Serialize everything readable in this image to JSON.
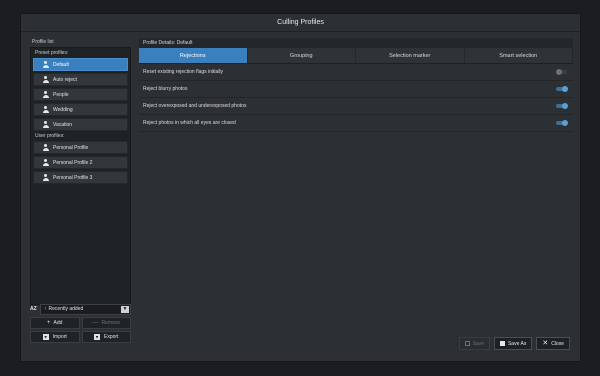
{
  "window": {
    "title": "Culling Profiles"
  },
  "left_panel": {
    "label": "Profile list",
    "preset_label": "Preset profiles:",
    "preset_profiles": [
      "Default",
      "Auto reject",
      "People",
      "Wedding",
      "Vacation"
    ],
    "user_label": "User profiles:",
    "user_profiles": [
      "Personal Profile",
      "Personal Profile 2",
      "Personal Profile 3"
    ],
    "sort_icon": "AZ",
    "sort_value": "Recently added",
    "add_label": "Add",
    "remove_label": "Remove",
    "import_label": "Import",
    "export_label": "Export"
  },
  "right_panel": {
    "header": "Profile Details: Default",
    "tabs": [
      "Rejections",
      "Grouping",
      "Selection marker",
      "Smart selection"
    ],
    "options": [
      {
        "label": "Reset existing rejection flags initially",
        "on": false
      },
      {
        "label": "Reject blurry photos",
        "on": true
      },
      {
        "label": "Reject overexposed and underexposed photos",
        "on": true
      },
      {
        "label": "Reject photos in which all eyes are closed",
        "on": true
      }
    ]
  },
  "footer": {
    "save_label": "Save",
    "save_as_label": "Save As",
    "close_label": "Close"
  },
  "colors": {
    "accent": "#3a7fbe",
    "toggle_on": "#5aa0d8"
  }
}
